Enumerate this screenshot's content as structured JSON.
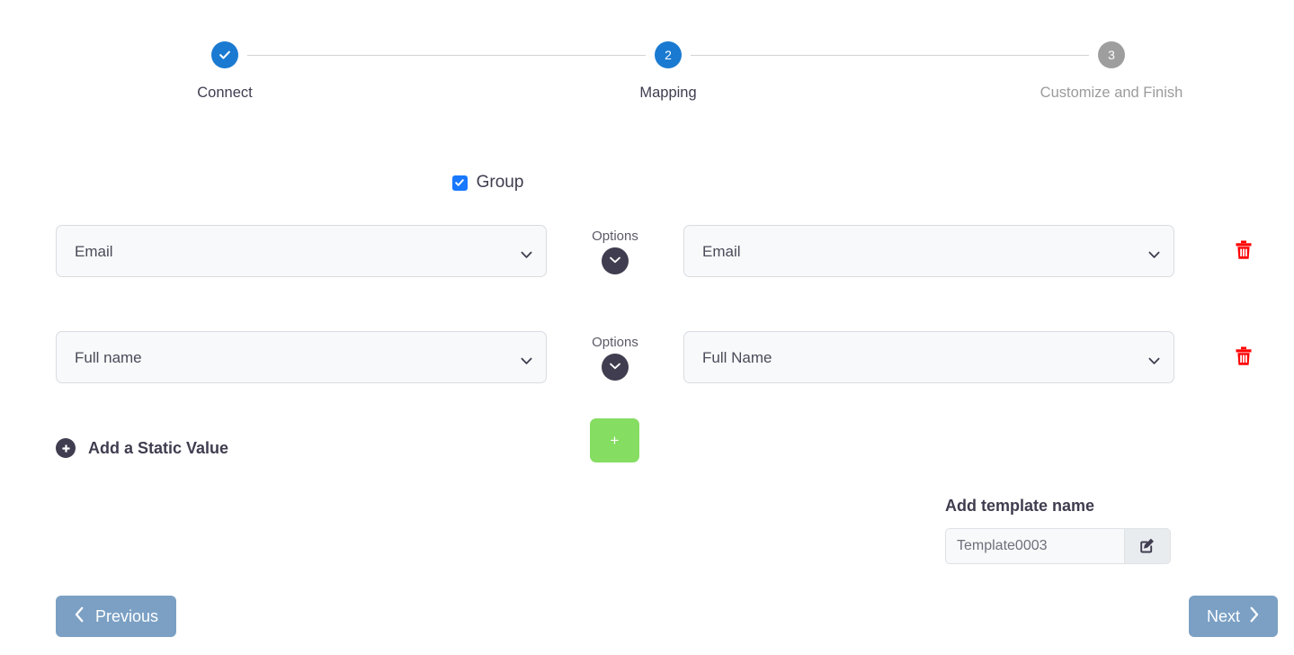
{
  "stepper": {
    "steps": [
      {
        "label": "Connect",
        "marker": "check",
        "state": "done"
      },
      {
        "label": "Mapping",
        "marker": "2",
        "state": "active"
      },
      {
        "label": "Customize and Finish",
        "marker": "3",
        "state": "todo"
      }
    ],
    "active_color": "#1a7ad1",
    "inactive_color": "#9e9e9e",
    "line_color": "#d3d3d3"
  },
  "group": {
    "label": "Group",
    "checked": true,
    "checkbox_color": "#1878ff"
  },
  "mapping": {
    "options_label": "Options",
    "rows": [
      {
        "source_value": "Email",
        "target_value": "Email",
        "options_icon": "chevron-down-icon",
        "delete_icon": "trash-icon"
      },
      {
        "source_value": "Full name",
        "target_value": "Full Name",
        "options_icon": "chevron-down-icon",
        "delete_icon": "trash-icon"
      }
    ],
    "source_options": [
      "Email",
      "Full name"
    ],
    "target_options": [
      "Email",
      "Full Name"
    ],
    "delete_color": "#ff0000",
    "options_button_color": "#3f3d4f"
  },
  "static_value": {
    "label": "Add a Static Value",
    "icon": "plus-circle-icon"
  },
  "add_row": {
    "label": "+",
    "color": "#85dd62"
  },
  "template": {
    "title": "Add template name",
    "value": "Template0003",
    "placeholder": "Template0003",
    "edit_icon": "pencil-square-icon"
  },
  "footer": {
    "previous_label": "Previous",
    "next_label": "Next",
    "button_color": "#7ba0c4"
  }
}
